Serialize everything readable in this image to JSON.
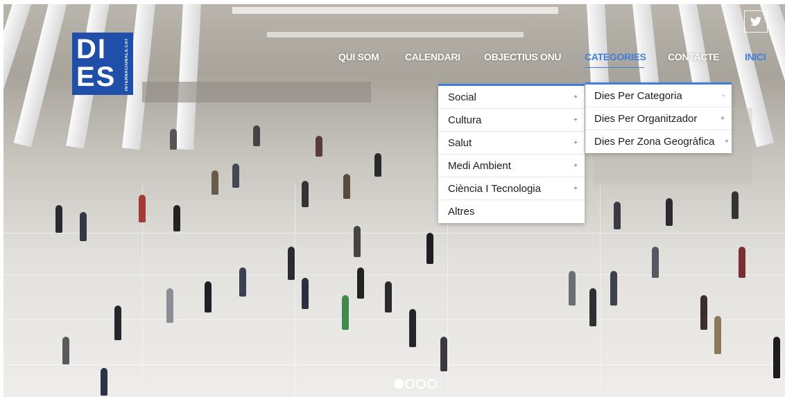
{
  "logo": {
    "letters_top": "DI",
    "letters_bottom": "ES",
    "subtitle": "INTERNACIONALS.CAT"
  },
  "social": {
    "twitter_icon": "twitter-icon"
  },
  "nav": {
    "items": [
      "QUI SOM",
      "CALENDARI",
      "OBJECTIUS ONU",
      "CATEGORIES",
      "CONTACTE",
      "INICI"
    ],
    "active": "CATEGORIES"
  },
  "categories_menu": {
    "items": [
      {
        "label": "Social",
        "sign": "+"
      },
      {
        "label": "Cultura",
        "sign": "+"
      },
      {
        "label": "Salut",
        "sign": "+"
      },
      {
        "label": "Medi Ambient",
        "sign": "+"
      },
      {
        "label": "Ciència I Tecnologia",
        "sign": "+"
      },
      {
        "label": "Altres",
        "sign": ""
      }
    ]
  },
  "categories_submenu": {
    "items": [
      {
        "label": "Dies Per Categoria",
        "sign": "-"
      },
      {
        "label": "Dies Per Organitzador",
        "sign": "+"
      },
      {
        "label": "Dies Per Zona Geogràfica",
        "sign": "+"
      }
    ]
  },
  "slider": {
    "count": 4,
    "active_index": 0
  },
  "colors": {
    "accent": "#3f7fd9",
    "logo_blue": "#1f4fa8",
    "nav_text": "#ffffff"
  }
}
